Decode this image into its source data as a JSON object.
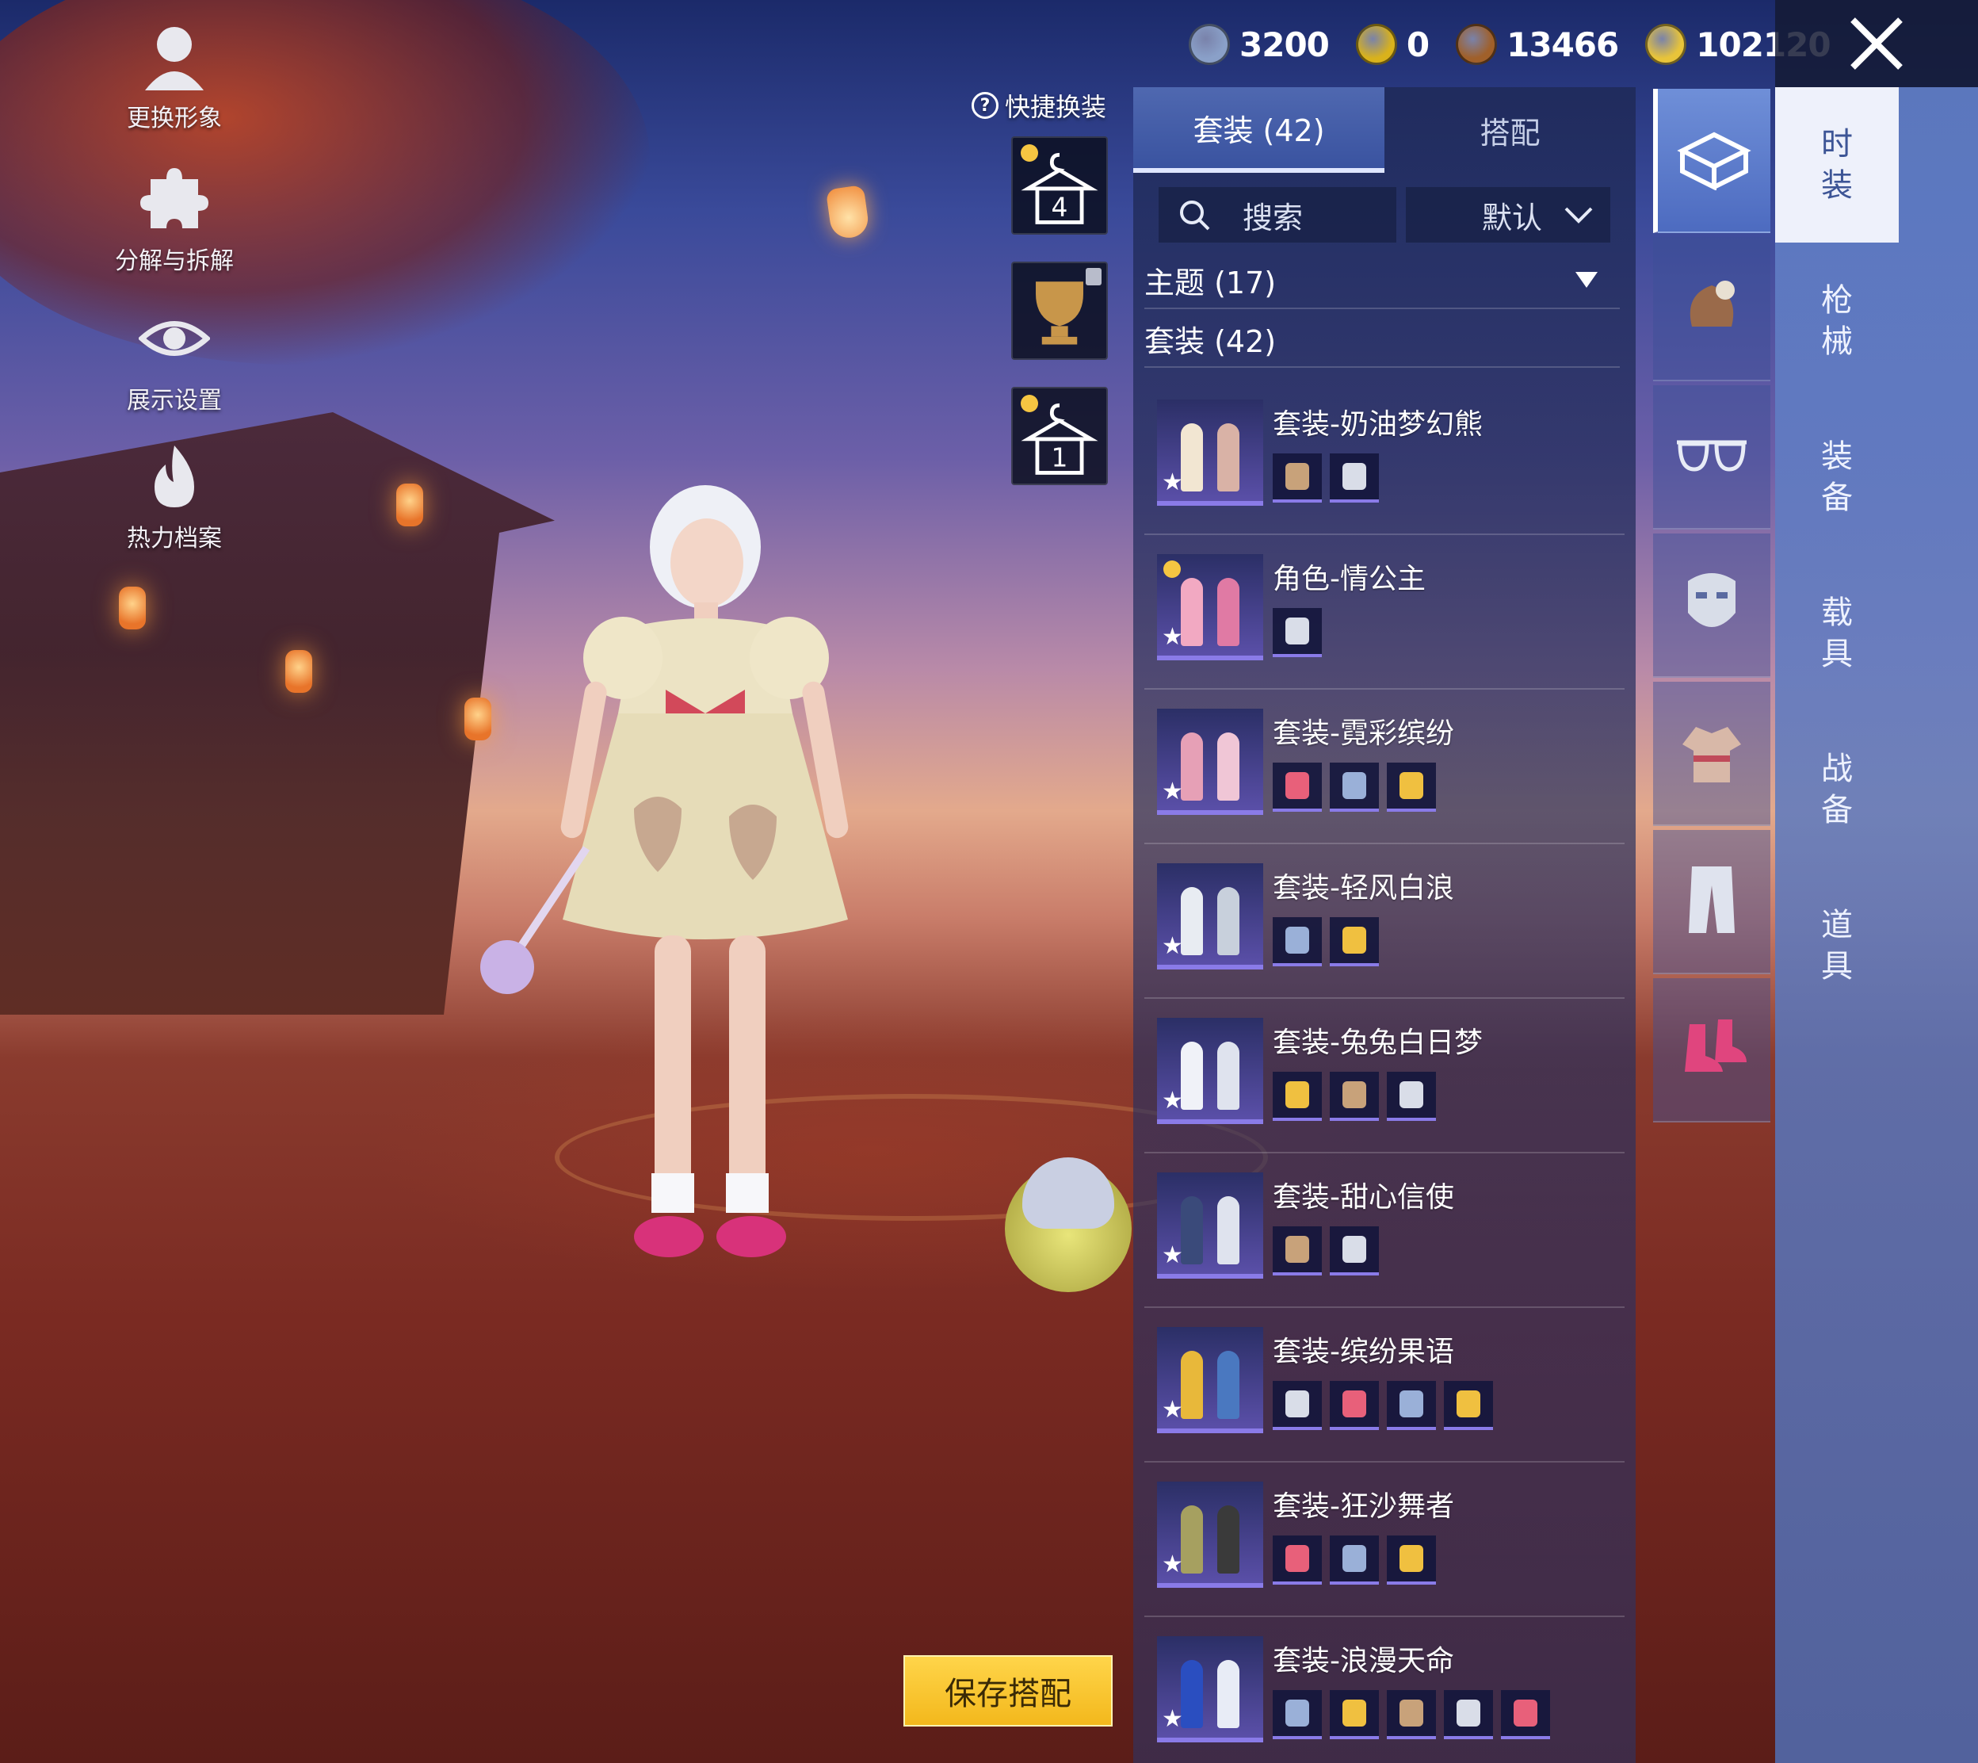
{
  "left_menu": {
    "change_appearance": "更换形象",
    "decompose": "分解与拆解",
    "display_settings": "展示设置",
    "heat_archive": "热力档案"
  },
  "quick_change": {
    "label": "快捷换装",
    "slots": [
      {
        "value": "4"
      },
      {
        "value": ""
      },
      {
        "value": "1"
      }
    ]
  },
  "currency": [
    {
      "icon": "uc-coin-icon",
      "value": "3200",
      "color": "#8aa0c8"
    },
    {
      "icon": "ag-coin-icon",
      "value": "0",
      "color": "#d9b21c"
    },
    {
      "icon": "bp-coin-icon",
      "value": "13466",
      "color": "#a0602a"
    },
    {
      "icon": "bolt-coin-icon",
      "value": "102120",
      "color": "#e8c43a"
    }
  ],
  "tabs": [
    {
      "label": "套装 (42)",
      "active": true
    },
    {
      "label": "搭配",
      "active": false
    }
  ],
  "search": {
    "label": "搜索",
    "sort": "默认"
  },
  "categories": [
    {
      "label": "主题 (17)"
    },
    {
      "label": "套装 (42)"
    }
  ],
  "items": [
    {
      "name": "套装-奶油梦幻熊",
      "parts": 2
    },
    {
      "name": "角色-情公主",
      "parts": 1
    },
    {
      "name": "套装-霓彩缤纷",
      "parts": 3
    },
    {
      "name": "套装-轻风白浪",
      "parts": 2
    },
    {
      "name": "套装-兔兔白日梦",
      "parts": 3
    },
    {
      "name": "套装-甜心信使",
      "parts": 2
    },
    {
      "name": "套装-缤纷果语",
      "parts": 4
    },
    {
      "name": "套装-狂沙舞者",
      "parts": 3
    },
    {
      "name": "套装-浪漫天命",
      "parts": 5
    }
  ],
  "category_icons": [
    "box-icon",
    "hat-icon",
    "glasses-icon",
    "mask-icon",
    "outfit-icon",
    "pants-icon",
    "shoes-icon"
  ],
  "right_nav": [
    {
      "label": "时装",
      "active": true
    },
    {
      "label": "枪械",
      "active": false
    },
    {
      "label": "装备",
      "active": false
    },
    {
      "label": "载具",
      "active": false
    },
    {
      "label": "战备",
      "active": false
    },
    {
      "label": "道具",
      "active": false
    }
  ],
  "save_button": "保存搭配",
  "colors": {
    "accent": "#4f68b0",
    "save": "#f3b81c",
    "rarity": "#8a7be8"
  }
}
